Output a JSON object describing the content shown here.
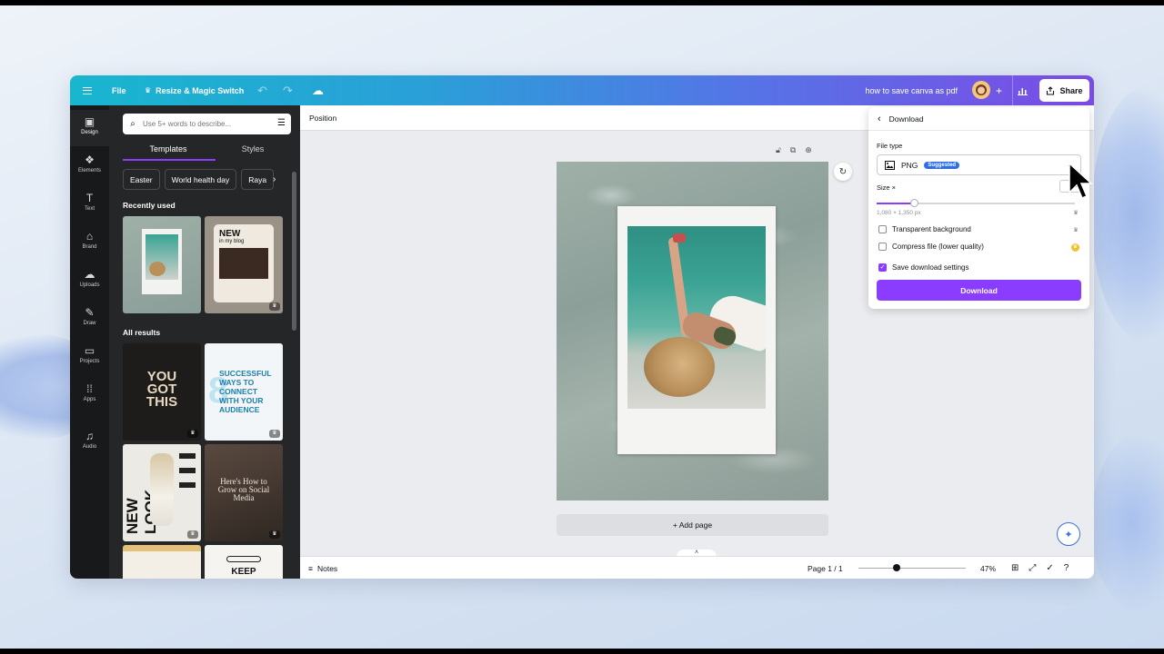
{
  "topbar": {
    "file_label": "File",
    "resize_label": "Resize & Magic Switch",
    "undo_icon": "undo-icon",
    "redo_icon": "redo-icon",
    "cloud_icon": "cloud-check-icon",
    "doc_title": "how to save canva as pdf",
    "share_label": "Share"
  },
  "rail": {
    "items": [
      {
        "label": "Design",
        "icon": "design-icon"
      },
      {
        "label": "Elements",
        "icon": "elements-icon"
      },
      {
        "label": "Text",
        "icon": "text-icon"
      },
      {
        "label": "Brand",
        "icon": "brand-icon"
      },
      {
        "label": "Uploads",
        "icon": "uploads-icon"
      },
      {
        "label": "Draw",
        "icon": "draw-icon"
      },
      {
        "label": "Projects",
        "icon": "projects-icon"
      },
      {
        "label": "Apps",
        "icon": "apps-icon"
      },
      {
        "label": "Audio",
        "icon": "audio-icon"
      }
    ]
  },
  "panel": {
    "search_placeholder": "Use 5+ words to describe...",
    "tabs": [
      {
        "label": "Templates"
      },
      {
        "label": "Styles"
      }
    ],
    "chips": [
      {
        "label": "Easter"
      },
      {
        "label": "World health day"
      },
      {
        "label": "Raya"
      }
    ],
    "recently_used_title": "Recently used",
    "all_results_title": "All results",
    "thumb_texts": {
      "blog_new": "NEW",
      "blog_sub": "in my blog",
      "you_got_this": "YOU GOT THIS",
      "successful": "SUCCESSFUL WAYS TO CONNECT WITH YOUR AUDIENCE",
      "new_look": "NEW LOOK",
      "grow": "Here's How to Grow on Social Media",
      "keep": "KEEP"
    }
  },
  "canvas": {
    "position_label": "Position",
    "add_page_label": "+ Add page"
  },
  "bottombar": {
    "notes_label": "Notes",
    "page_indicator": "Page 1 / 1",
    "zoom_percent": "47%",
    "zoom_fraction": 0.36
  },
  "download": {
    "title": "Download",
    "file_type_label": "File type",
    "file_type_value": "PNG",
    "suggested_badge": "Suggested",
    "size_label": "Size ×",
    "size_value": "1",
    "size_fraction": 0.19,
    "dimensions": "1,080 × 1,350 px",
    "transparent_label": "Transparent background",
    "compress_label": "Compress file (lower quality)",
    "save_settings_label": "Save download settings",
    "save_settings_checked": true,
    "download_button": "Download"
  },
  "colors": {
    "accent": "#8b3dff",
    "topbar_start": "#18b6cf",
    "topbar_end": "#7c4be6",
    "badge": "#2e6ee6"
  }
}
